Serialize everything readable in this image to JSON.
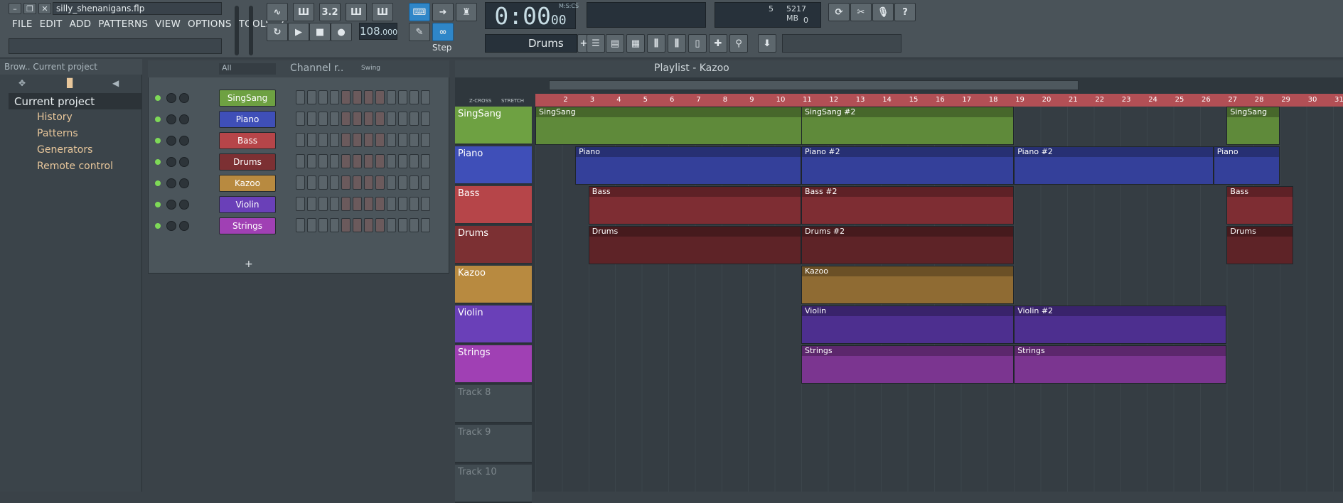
{
  "window": {
    "title": "silly_shenanigans.flp"
  },
  "menu": [
    "FILE",
    "EDIT",
    "ADD",
    "PATTERNS",
    "VIEW",
    "OPTIONS",
    "TOOLS",
    "?"
  ],
  "transport": {
    "time": "0:00",
    "time_sub": "00",
    "time_unit": "M:S:CS",
    "bpm": "108",
    "bpm_frac": ".000",
    "mode": "Step"
  },
  "pattern_selector": "Drums",
  "cpu": {
    "voices": "5",
    "mem": "5217 MB",
    "voices2": "0"
  },
  "browser": {
    "header": "Brow.. Current project",
    "items": [
      "Current project",
      "History",
      "Patterns",
      "Generators",
      "Remote control"
    ]
  },
  "channel_rack": {
    "filter": "All",
    "title": "Channel r..",
    "swing_label": "Swing",
    "add": "+",
    "channels": [
      {
        "name": "SingSang",
        "color": "#6ea142"
      },
      {
        "name": "Piano",
        "color": "#3f4fb8"
      },
      {
        "name": "Bass",
        "color": "#b64549"
      },
      {
        "name": "Drums",
        "color": "#7c3033"
      },
      {
        "name": "Kazoo",
        "color": "#b88a40"
      },
      {
        "name": "Violin",
        "color": "#6a40b8"
      },
      {
        "name": "Strings",
        "color": "#a040b4"
      }
    ]
  },
  "playlist": {
    "title": "Playlist - Kazoo",
    "zcross": "Z-CROSS",
    "stretch": "STRETCH",
    "bars": [
      "2",
      "3",
      "4",
      "5",
      "6",
      "7",
      "8",
      "9",
      "10",
      "11",
      "12",
      "13",
      "14",
      "15",
      "16",
      "17",
      "18",
      "19",
      "20",
      "21",
      "22",
      "23",
      "24",
      "25",
      "26",
      "27",
      "28",
      "29",
      "30",
      "31"
    ],
    "tracks": [
      {
        "name": "SingSang",
        "color": "#6ea142"
      },
      {
        "name": "Piano",
        "color": "#3f4fb8"
      },
      {
        "name": "Bass",
        "color": "#b64549"
      },
      {
        "name": "Drums",
        "color": "#7c3033"
      },
      {
        "name": "Kazoo",
        "color": "#b88a40"
      },
      {
        "name": "Violin",
        "color": "#6a40b8"
      },
      {
        "name": "Strings",
        "color": "#a040b4"
      },
      {
        "name": "Track 8",
        "color": ""
      },
      {
        "name": "Track 9",
        "color": ""
      },
      {
        "name": "Track 10",
        "color": ""
      }
    ],
    "clips": [
      {
        "track": 0,
        "label": "SingSang",
        "start": 1,
        "end": 19,
        "color": "#5f8a3a"
      },
      {
        "track": 0,
        "label": "SingSang #2",
        "start": 11,
        "end": 19,
        "color": "#5f8a3a"
      },
      {
        "track": 0,
        "label": "SingSang",
        "start": 27,
        "end": 29,
        "color": "#5f8a3a"
      },
      {
        "track": 1,
        "label": "Piano",
        "start": 2.5,
        "end": 11,
        "color": "#34409a"
      },
      {
        "track": 1,
        "label": "Piano #2",
        "start": 11,
        "end": 19,
        "color": "#34409a"
      },
      {
        "track": 1,
        "label": "Piano #2",
        "start": 19,
        "end": 26.5,
        "color": "#34409a"
      },
      {
        "track": 1,
        "label": "Piano",
        "start": 26.5,
        "end": 29,
        "color": "#34409a"
      },
      {
        "track": 2,
        "label": "Bass",
        "start": 3,
        "end": 11,
        "color": "#7e2d33"
      },
      {
        "track": 2,
        "label": "Bass #2",
        "start": 11,
        "end": 19,
        "color": "#7e2d33"
      },
      {
        "track": 2,
        "label": "Bass",
        "start": 27,
        "end": 29.5,
        "color": "#7e2d33"
      },
      {
        "track": 3,
        "label": "Drums",
        "start": 3,
        "end": 11,
        "color": "#5e2327"
      },
      {
        "track": 3,
        "label": "Drums #2",
        "start": 11,
        "end": 19,
        "color": "#5e2327"
      },
      {
        "track": 3,
        "label": "Drums",
        "start": 27,
        "end": 29.5,
        "color": "#5e2327"
      },
      {
        "track": 4,
        "label": "Kazoo",
        "start": 11,
        "end": 19,
        "color": "#8f6b33"
      },
      {
        "track": 5,
        "label": "Violin",
        "start": 11,
        "end": 19,
        "color": "#4d2f8f"
      },
      {
        "track": 5,
        "label": "Violin #2",
        "start": 19,
        "end": 27,
        "color": "#4d2f8f"
      },
      {
        "track": 6,
        "label": "Strings",
        "start": 11,
        "end": 19,
        "color": "#7b3590"
      },
      {
        "track": 6,
        "label": "Strings",
        "start": 19,
        "end": 27,
        "color": "#7b3590"
      }
    ]
  }
}
